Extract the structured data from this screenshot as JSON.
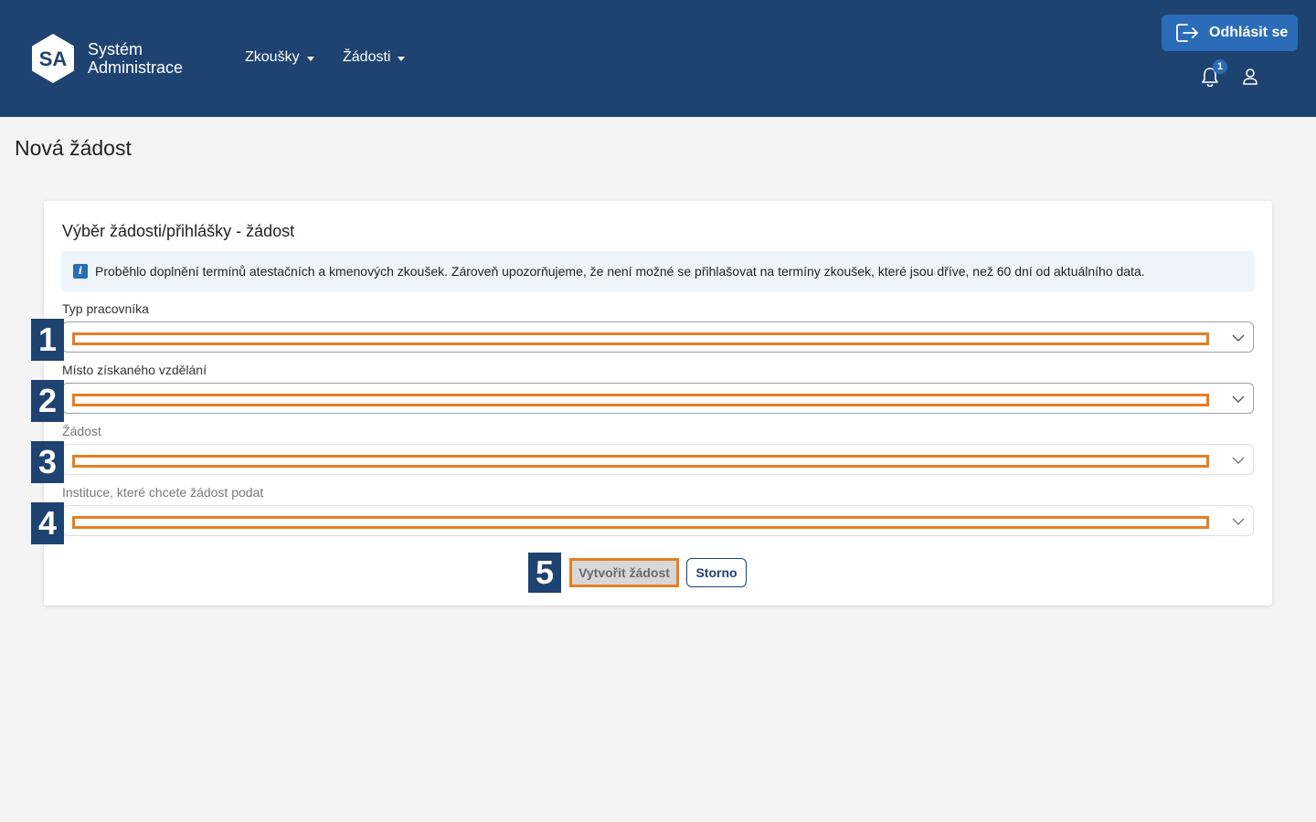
{
  "header": {
    "logo_text": "SA",
    "brand_line1": "Systém",
    "brand_line2": "Administrace",
    "nav": [
      {
        "label": "Zkoušky"
      },
      {
        "label": "Žádosti"
      }
    ],
    "logout_label": "Odhlásit se",
    "notification_count": "1"
  },
  "page": {
    "title": "Nová žádost"
  },
  "card": {
    "title": "Výběr žádosti/přihlášky - žádost",
    "info_icon": "i",
    "info_text": "Proběhlo doplnění termínů atestačních a kmenových zkoušek. Zároveň upozorňujeme, že není možné se přihlašovat na termíny zkoušek, které jsou dříve, než 60 dní od aktuálního data.",
    "fields": [
      {
        "label": "Typ pracovníka",
        "badge": "1",
        "value": ""
      },
      {
        "label": "Místo získaného vzdělání",
        "badge": "2",
        "value": ""
      },
      {
        "label": "Žádost",
        "badge": "3",
        "value": ""
      },
      {
        "label": "Instituce, které chcete žádost podat",
        "badge": "4",
        "value": ""
      }
    ],
    "actions_badge": "5",
    "create_label": "Vytvořit žádost",
    "cancel_label": "Storno"
  },
  "colors": {
    "header_bg": "#1e4370",
    "accent": "#2b6cb8",
    "highlight": "#e87e24",
    "page_bg": "#f4f4f4"
  },
  "icons": [
    "logo-hexagon-icon",
    "caret-down-icon",
    "logout-icon",
    "bell-icon",
    "user-icon",
    "info-icon",
    "chevron-down-icon"
  ]
}
